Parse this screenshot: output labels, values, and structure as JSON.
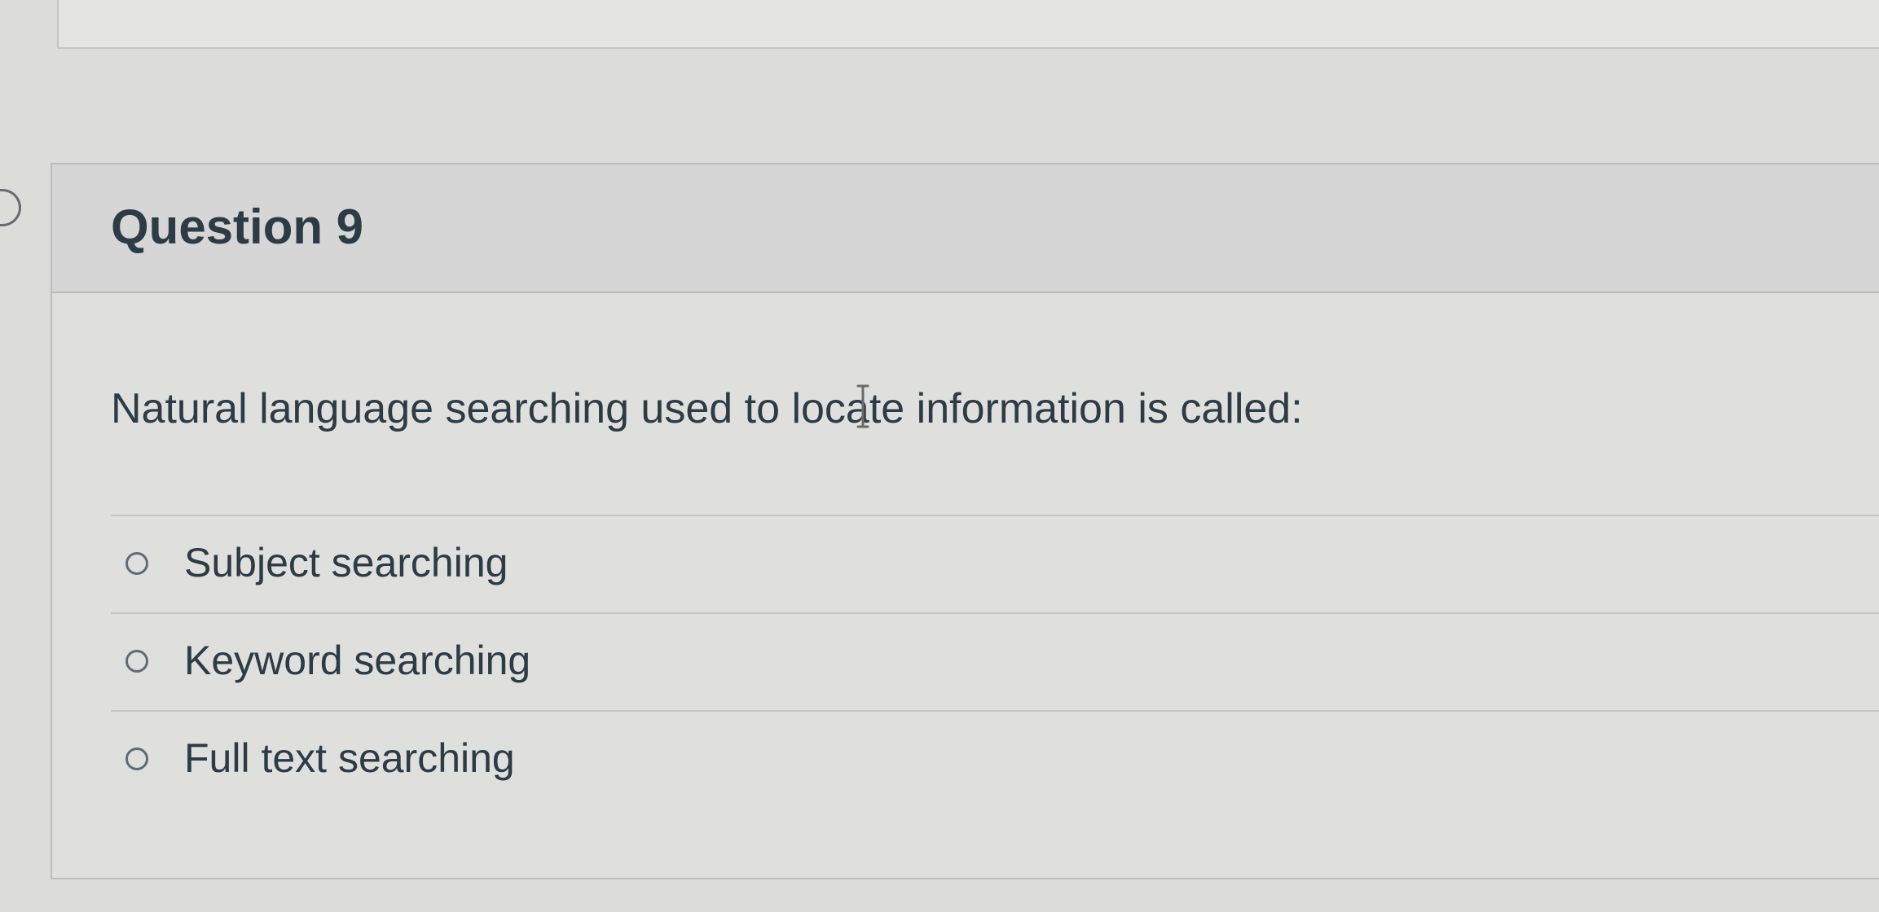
{
  "question": {
    "title": "Question 9",
    "text": "Natural language searching used to locate information is called:",
    "options": [
      {
        "label": "Subject searching",
        "selected": false
      },
      {
        "label": "Keyword searching",
        "selected": false
      },
      {
        "label": "Full text searching",
        "selected": false
      }
    ]
  },
  "icons": {
    "question_indicator": "question-pointer-icon",
    "option_marker": "radio-button-icon",
    "cursor": "text-cursor-icon"
  },
  "colors": {
    "text": "#2d3b45",
    "border": "#bbbcbb",
    "header_background": "#d5d6d5"
  }
}
